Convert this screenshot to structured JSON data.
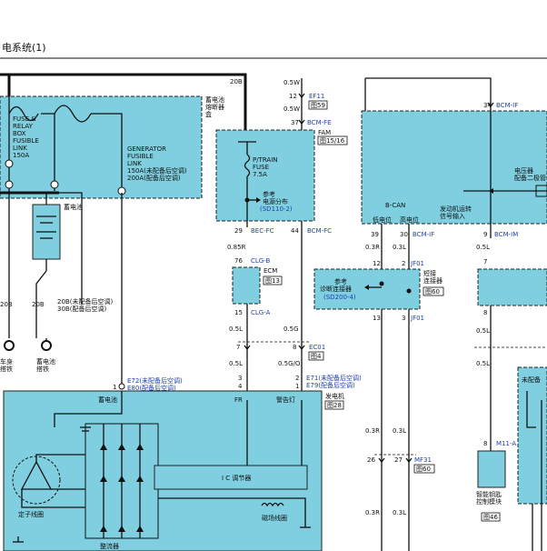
{
  "header": {
    "title": "电系统(1)"
  },
  "battery_fuse_box": {
    "fuse_relay_label": "FUSE &\nRELAY\nBOX\nFUSIBLE\nLINK\n150A",
    "generator_label": "GENERATOR\nFUSIBLE\nLINK\n150A(未配备后空调)\n200A(配备后空调)",
    "title": "蓄电池\n熔断器\n盒",
    "battery_label": "蓄电池"
  },
  "wires_left": {
    "top": "20B",
    "w1": "20B",
    "w2": "20B",
    "w3": "20B(未配备后空调)\n30B(配备后空调)",
    "body_ground": "车身\n搭铁",
    "battery_ground": "蓄电池\n搭铁"
  },
  "ptrain_fuse": {
    "label": "P/TRAIN\nFUSE\n7.5A",
    "ref_text": "参考\n电源分布",
    "ref_code": "(SD110-2)"
  },
  "upper_connectors": {
    "w_top1": "0.5W",
    "pin12": "12",
    "ef11": "EF11",
    "fig59": "图59",
    "w_top2": "0.5W",
    "pin37": "37",
    "bcm_fe": "BCM-FE",
    "fam": "FAM",
    "fig1516": "图15/16"
  },
  "center_wires": {
    "pin29": "29",
    "bec_fc": "BEC-FC",
    "pin44": "44",
    "bcm_fc": "BCM-FC",
    "w085r": "0.85R",
    "pin76": "76",
    "clg_b": "CLG-B",
    "ecm": "ECM",
    "fig13": "图13",
    "pin15": "15",
    "clg_a": "CLG-A",
    "w05l_1": "0.5L",
    "w05g": "0.5G",
    "pin7": "7",
    "pin8": "8",
    "ec01": "EC01",
    "fig4": "图4",
    "w05l_2": "0.5L",
    "w05go": "0.5G/O",
    "pin3": "3",
    "pin4": "4",
    "pin2": "2",
    "pin1": "1",
    "e71": "E71(未配备后空调)",
    "e79": "E79(配备后空调)",
    "generator": "发电机",
    "fig28": "图28"
  },
  "left_connector": {
    "pin1": "1",
    "e72": "E72(未配备后空调)",
    "e80": "E80(配备后空调)"
  },
  "alternator": {
    "battery_terminal": "蓄电池",
    "fr": "FR",
    "warning_lamp": "警告灯",
    "ic_regulator": "I C 调节器",
    "stator": "定子线圈",
    "rotor": "磁场线圈",
    "rectifier": "整流器"
  },
  "bcm_right": {
    "pin34": "34",
    "bcm_if": "BCM-IF",
    "bcan": "B-CAN",
    "low": "低电位",
    "high": "高电位",
    "sensor_title": "电压器\n配备二极管",
    "engine_signal": "发动机运转\n信号输入",
    "pin39": "39",
    "pin30": "30",
    "bcm_if2": "BCM-IF",
    "pin9": "9",
    "bcm_im": "BCM-IM",
    "w03r": "0.3R",
    "w03l": "0.3L",
    "w05l": "0.5L"
  },
  "joint_connector": {
    "pin12": "12",
    "pin2": "2",
    "jf01_top": "JF01",
    "ref_text": "参考\n诊断连接器",
    "ref_code": "(SD200-4)",
    "title": "短接\n连接器",
    "fig60": "图60",
    "pin13": "13",
    "pin3": "3",
    "jf01_bot": "JF01",
    "pin7": "7",
    "pin8": "8",
    "w05l_a": "0.5L",
    "w05l_b": "0.5L"
  },
  "lower_right": {
    "w03r_1": "0.3R",
    "w03l_1": "0.3L",
    "pin26": "26",
    "pin27": "27",
    "mf31": "MF31",
    "fig60": "图60",
    "w03r_2": "0.3R",
    "w03l_2": "0.3L",
    "pin8": "8",
    "m11_a": "M11-A",
    "smart_key": "智能钥匙\n控制模块",
    "fig46": "图46",
    "unconfigured": "未配备"
  }
}
